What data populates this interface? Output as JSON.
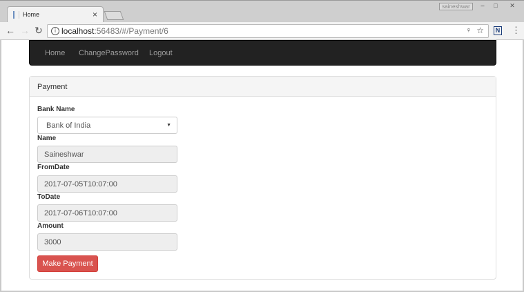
{
  "browser": {
    "tab_title": "Home",
    "user": "saineshwar",
    "url_host": "localhost",
    "url_rest": ":56483/#/Payment/6"
  },
  "navbar": {
    "items": [
      "Home",
      "ChangePassword",
      "Logout"
    ]
  },
  "panel": {
    "title": "Payment",
    "bank_label": "Bank Name",
    "bank_value": "Bank of India",
    "name_label": "Name",
    "name_value": "Saineshwar",
    "from_label": "FromDate",
    "from_value": "2017-07-05T10:07:00",
    "to_label": "ToDate",
    "to_value": "2017-07-06T10:07:00",
    "amount_label": "Amount",
    "amount_value": "3000",
    "submit_label": "Make Payment"
  },
  "colors": {
    "accent": "#d9534f",
    "navbar": "#222222"
  }
}
